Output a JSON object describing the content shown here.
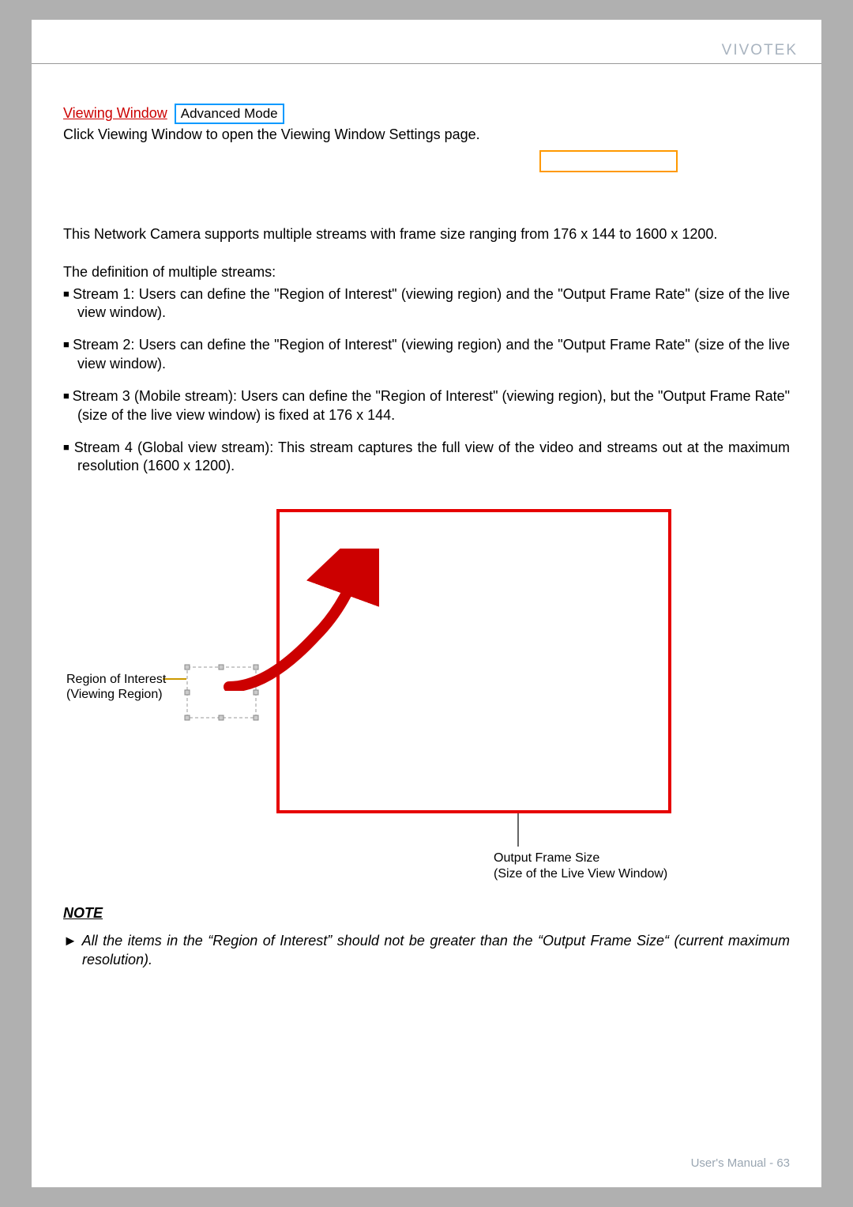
{
  "brand": "VIVOTEK",
  "heading_link": "Viewing Window",
  "mode_badge": "Advanced Mode",
  "intro": "Click Viewing Window   to open the Viewing Window Settings page.",
  "para_support": "This Network Camera supports multiple streams with frame size ranging from 176 x 144 to 1600 x 1200.",
  "subhead": "The definition of multiple streams:",
  "bullets": [
    "Stream 1: Users can define the \"Region of Interest\" (viewing region) and the \"Output Frame Rate\" (size of the live view window).",
    "Stream 2: Users can define the \"Region of Interest\" (viewing region) and the \"Output Frame Rate\" (size of the live view window).",
    "Stream 3 (Mobile stream): Users can define the \"Region of Interest\" (viewing region), but the \"Output Frame Rate\" (size of the live view window) is fixed at 176 x 144.",
    "Stream 4 (Global view stream): This stream captures the full view of the video and streams out at the maximum resolution (1600 x 1200)."
  ],
  "roi_label_line1": "Region of Interest",
  "roi_label_line2": "(Viewing Region)",
  "size_label_line1": "Output Frame Size",
  "size_label_line2": "(Size of the Live View Window)",
  "note_head": "NOTE",
  "note_body": "All the items in the “Region of Interest” should not be greater than the “Output Frame Size“ (current maximum resolution).",
  "footer_label": "User's Manual - ",
  "footer_page": "63"
}
